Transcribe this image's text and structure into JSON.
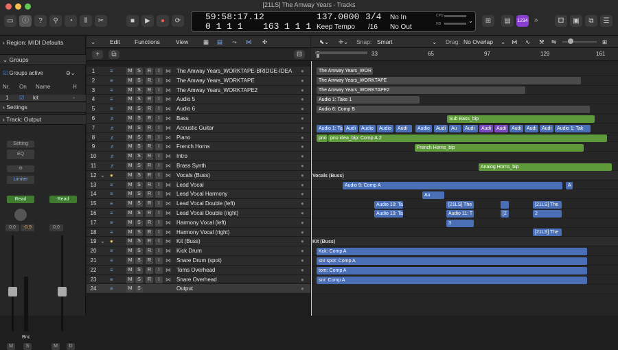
{
  "window": {
    "title": "[21LS] The Amway Years - Tracks"
  },
  "lcd": {
    "time": "59:58:17.12",
    "bars": "0 1 1 1",
    "beats": "163 1 1 1",
    "tempo": "137.0000",
    "tempo_mode": "Keep Tempo",
    "sig": "3/4",
    "div": "/16",
    "in": "No In",
    "out": "No Out",
    "cpu": "CPU",
    "hd": "HD"
  },
  "toolbar": {
    "badge": "1234"
  },
  "inspector": {
    "region": "Region: MIDI Defaults",
    "groups": "Groups",
    "groups_active": "Groups active",
    "col_nr": "Nr.",
    "col_on": "On",
    "col_name": "Name",
    "col_h": "H",
    "grp_nr": "1",
    "grp_name": "kit",
    "settings": "Settings",
    "track": "Track:  Output",
    "setting": "Setting",
    "eq": "EQ",
    "limiter": "Limiter",
    "read1": "Read",
    "read2": "Read",
    "val1": "0.0",
    "val2": "-0.9",
    "val3": "0.0",
    "bnc": "Bnc",
    "m1": "M",
    "s1": "S",
    "m2": "M",
    "d2": "D"
  },
  "trackmenu": {
    "edit": "Edit",
    "functions": "Functions",
    "view": "View"
  },
  "arrange": {
    "snap_label": "Snap:",
    "snap": "Smart",
    "drag_label": "Drag:",
    "drag": "No Overlap"
  },
  "ruler": [
    "1",
    "33",
    "65",
    "97",
    "129",
    "161"
  ],
  "tracks": [
    {
      "n": "1",
      "name": "The Amway Years_WORKTAPE-BRIDGE-IDEA"
    },
    {
      "n": "2",
      "name": "The Amway Years_WORKTAPE"
    },
    {
      "n": "3",
      "name": "The Amway Years_WORKTAPE2"
    },
    {
      "n": "4",
      "name": "Audio 5"
    },
    {
      "n": "5",
      "name": "Audio 6"
    },
    {
      "n": "6",
      "name": "Bass"
    },
    {
      "n": "7",
      "name": "Acoustic Guitar"
    },
    {
      "n": "8",
      "name": "Piano"
    },
    {
      "n": "9",
      "name": "French Horns"
    },
    {
      "n": "10",
      "name": "Intro"
    },
    {
      "n": "11",
      "name": "Brass Synth"
    },
    {
      "n": "12",
      "name": "Vocals (Buss)"
    },
    {
      "n": "13",
      "name": "Lead Vocal"
    },
    {
      "n": "14",
      "name": "Lead Vocal Harmony"
    },
    {
      "n": "15",
      "name": "Lead Vocal Double (left)"
    },
    {
      "n": "16",
      "name": "Lead Vocal Double (right)"
    },
    {
      "n": "17",
      "name": "Harmony Vocal (left)"
    },
    {
      "n": "18",
      "name": "Harmony Vocal (right)"
    },
    {
      "n": "19",
      "name": "Kit (Buss)"
    },
    {
      "n": "20",
      "name": "Kick Drum"
    },
    {
      "n": "21",
      "name": "Snare Drum (spot)"
    },
    {
      "n": "22",
      "name": "Toms Overhead"
    },
    {
      "n": "23",
      "name": "Snare Overhead"
    },
    {
      "n": "24",
      "name": "Output"
    }
  ],
  "regions": {
    "r1": "The Amway Years_WOR",
    "r2": "The Amway Years_WORKTAPE",
    "r3": "The Amway Years_WORKTAPE2",
    "r4": "Audio 1: Take 1",
    "r5": "Audio 6: Comp B",
    "r6": "Sub Bass_bip",
    "r7a": "Audio 1: Tak",
    "r7b": "Audi",
    "r7c": "Audio",
    "r7d": "Au",
    "r7e": "Audio 1: Tak",
    "r8a": "pno",
    "r8b": "pno idea_bip: Comp A.2",
    "r9": "French Horns_bip",
    "r11": "Analog Horns_bip",
    "bus1": "Vocals (Buss)",
    "r13": "Audio 9: Comp A",
    "r13b": "A",
    "r14": "Au",
    "r15a": "Audio 10: Ta",
    "r15b": "[21LS] The",
    "r15c": "[21LS] The",
    "r16a": "Audio 10: Ta",
    "r16b": "Audio 11: T",
    "r16c": "[2",
    "r16d": "2",
    "r17": "3",
    "r18": "[21LS] The",
    "bus2": "Kit (Buss)",
    "r20": "Kck: Comp A",
    "r21": "snr spot: Comp A",
    "r22": "tom: Comp A",
    "r23": "snr: Comp A"
  }
}
